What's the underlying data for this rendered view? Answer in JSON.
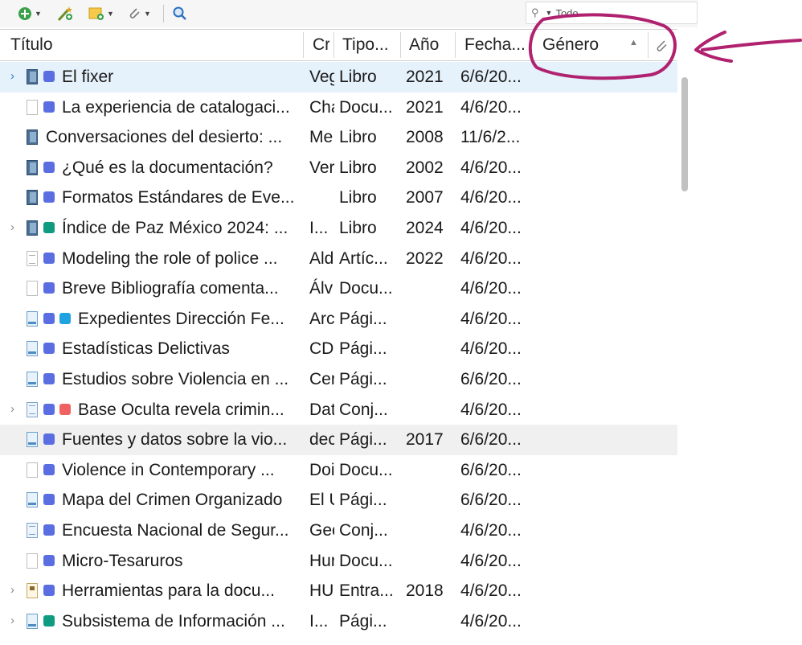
{
  "toolbar": {
    "buttons": [
      {
        "icon": "new-item-icon",
        "color": "#3aa04a"
      },
      {
        "icon": "add-by-identifier-icon",
        "color": "#6b8f2a"
      },
      {
        "icon": "new-note-icon",
        "color": "#e0a020"
      },
      {
        "icon": "add-attachment-icon",
        "color": "#777777"
      },
      {
        "icon": "locate-icon",
        "color": "#2b6fc2"
      }
    ],
    "search_mode": "Todo"
  },
  "columns": {
    "title": "Título",
    "creator": "Creador",
    "type": "Tipo...",
    "year": "Año",
    "date": "Fecha...",
    "genre": "Género",
    "attachment_icon": "paperclip-icon"
  },
  "tag_colors": {
    "blue": "#5b6ee1",
    "green": "#0e9b80",
    "cyan": "#1fa3e0",
    "red": "#f06262"
  },
  "rows": [
    {
      "twisty": "›",
      "icon": "book",
      "tags": [
        "blue"
      ],
      "title": "El fixer",
      "creator": "Veg",
      "type": "Libro",
      "year": "2021",
      "date": "6/6/20...",
      "selected": true
    },
    {
      "twisty": "",
      "icon": "doc",
      "tags": [
        "blue"
      ],
      "title": "La experiencia de catalogaci...",
      "creator": "Cha",
      "type": "Docu...",
      "year": "2021",
      "date": "4/6/20..."
    },
    {
      "twisty": "",
      "icon": "book",
      "tags": [],
      "title": "Conversaciones del desierto: ...",
      "creator": "Me",
      "type": "Libro",
      "year": "2008",
      "date": "11/6/2..."
    },
    {
      "twisty": "",
      "icon": "book",
      "tags": [
        "blue"
      ],
      "title": "¿Qué es la documentación?",
      "creator": "Ver",
      "type": "Libro",
      "year": "2002",
      "date": "4/6/20..."
    },
    {
      "twisty": "",
      "icon": "book",
      "tags": [
        "blue"
      ],
      "title": "Formatos Estándares de Eve...",
      "creator": "",
      "type": "Libro",
      "year": "2007",
      "date": "4/6/20..."
    },
    {
      "twisty": "›",
      "icon": "book",
      "tags": [
        "green"
      ],
      "title": "Índice de Paz México 2024: ...",
      "creator": "I...",
      "type": "Libro",
      "year": "2024",
      "date": "4/6/20..."
    },
    {
      "twisty": "",
      "icon": "art",
      "tags": [
        "blue"
      ],
      "title": "Modeling the role of police ...",
      "creator": "Ald",
      "type": "Artíc...",
      "year": "2022",
      "date": "4/6/20..."
    },
    {
      "twisty": "",
      "icon": "doc",
      "tags": [
        "blue"
      ],
      "title": "Breve Bibliografía comenta...",
      "creator": "Álv",
      "type": "Docu...",
      "year": "",
      "date": "4/6/20..."
    },
    {
      "twisty": "",
      "icon": "web",
      "tags": [
        "blue",
        "cyan"
      ],
      "title": "Expedientes Dirección Fe...",
      "creator": "Arc",
      "type": "Pági...",
      "year": "",
      "date": "4/6/20..."
    },
    {
      "twisty": "",
      "icon": "web",
      "tags": [
        "blue"
      ],
      "title": "Estadísticas Delictivas",
      "creator": "CD",
      "type": "Pági...",
      "year": "",
      "date": "4/6/20..."
    },
    {
      "twisty": "",
      "icon": "web",
      "tags": [
        "blue"
      ],
      "title": "Estudios sobre Violencia en ...",
      "creator": "Cer",
      "type": "Pági...",
      "year": "",
      "date": "6/6/20..."
    },
    {
      "twisty": "›",
      "icon": "data",
      "tags": [
        "blue",
        "red"
      ],
      "title": "Base Oculta revela crimin...",
      "creator": "Dat",
      "type": "Conj...",
      "year": "",
      "date": "4/6/20..."
    },
    {
      "twisty": "",
      "icon": "web",
      "tags": [
        "blue"
      ],
      "title": "Fuentes y datos sobre la vio...",
      "creator": "dec",
      "type": "Pági...",
      "year": "2017",
      "date": "6/6/20...",
      "alt": true
    },
    {
      "twisty": "",
      "icon": "doc",
      "tags": [
        "blue"
      ],
      "title": "Violence in Contemporary ...",
      "creator": "Doi",
      "type": "Docu...",
      "year": "",
      "date": "6/6/20..."
    },
    {
      "twisty": "",
      "icon": "web",
      "tags": [
        "blue"
      ],
      "title": "Mapa del Crimen Organizado",
      "creator": "El U",
      "type": "Pági...",
      "year": "",
      "date": "6/6/20..."
    },
    {
      "twisty": "",
      "icon": "data",
      "tags": [
        "blue"
      ],
      "title": "Encuesta Nacional de Segur...",
      "creator": "Geo",
      "type": "Conj...",
      "year": "",
      "date": "4/6/20..."
    },
    {
      "twisty": "",
      "icon": "doc",
      "tags": [
        "blue"
      ],
      "title": "Micro-Tesaruros",
      "creator": "Hur",
      "type": "Docu...",
      "year": "",
      "date": "4/6/20..."
    },
    {
      "twisty": "›",
      "icon": "interview",
      "tags": [
        "blue"
      ],
      "title": "Herramientas para la docu...",
      "creator": "HU",
      "type": "Entra...",
      "year": "2018",
      "date": "4/6/20..."
    },
    {
      "twisty": "›",
      "icon": "web",
      "tags": [
        "green"
      ],
      "title": "Subsistema de Información ...",
      "creator": "I...",
      "type": "Pági...",
      "year": "",
      "date": "4/6/20..."
    }
  ]
}
